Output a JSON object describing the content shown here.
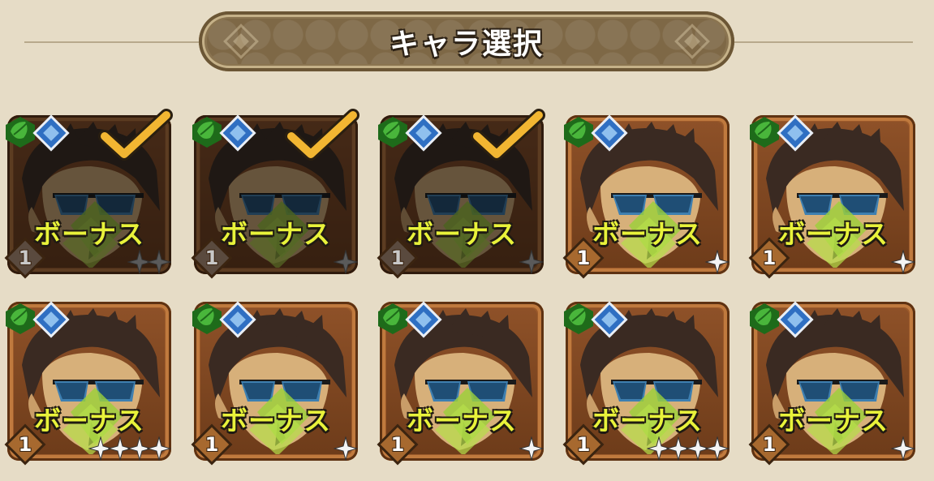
{
  "header": {
    "title": "キャラ選択"
  },
  "cards": [
    {
      "bonus_label": "ボーナス",
      "level": "1",
      "stars": 2,
      "selected": true
    },
    {
      "bonus_label": "ボーナス",
      "level": "1",
      "stars": 1,
      "selected": true
    },
    {
      "bonus_label": "ボーナス",
      "level": "1",
      "stars": 1,
      "selected": true
    },
    {
      "bonus_label": "ボーナス",
      "level": "1",
      "stars": 1,
      "selected": false
    },
    {
      "bonus_label": "ボーナス",
      "level": "1",
      "stars": 1,
      "selected": false
    },
    {
      "bonus_label": "ボーナス",
      "level": "1",
      "stars": 4,
      "selected": false
    },
    {
      "bonus_label": "ボーナス",
      "level": "1",
      "stars": 1,
      "selected": false
    },
    {
      "bonus_label": "ボーナス",
      "level": "1",
      "stars": 1,
      "selected": false
    },
    {
      "bonus_label": "ボーナス",
      "level": "1",
      "stars": 4,
      "selected": false
    },
    {
      "bonus_label": "ボーナス",
      "level": "1",
      "stars": 1,
      "selected": false
    }
  ],
  "icons": {
    "element": "leaf-element-icon",
    "rarity": "blue-diamond-rarity-icon",
    "check": "checkmark-icon",
    "level": "level-diamond-icon",
    "star": "star-icon"
  },
  "colors": {
    "background": "#e6dcc6",
    "frame": "#9c5a2a",
    "bonus_text": "#e8f23a",
    "check": "#f2b632",
    "element_green": "#2f8a2a",
    "rarity_blue": "#2f6fc2"
  }
}
